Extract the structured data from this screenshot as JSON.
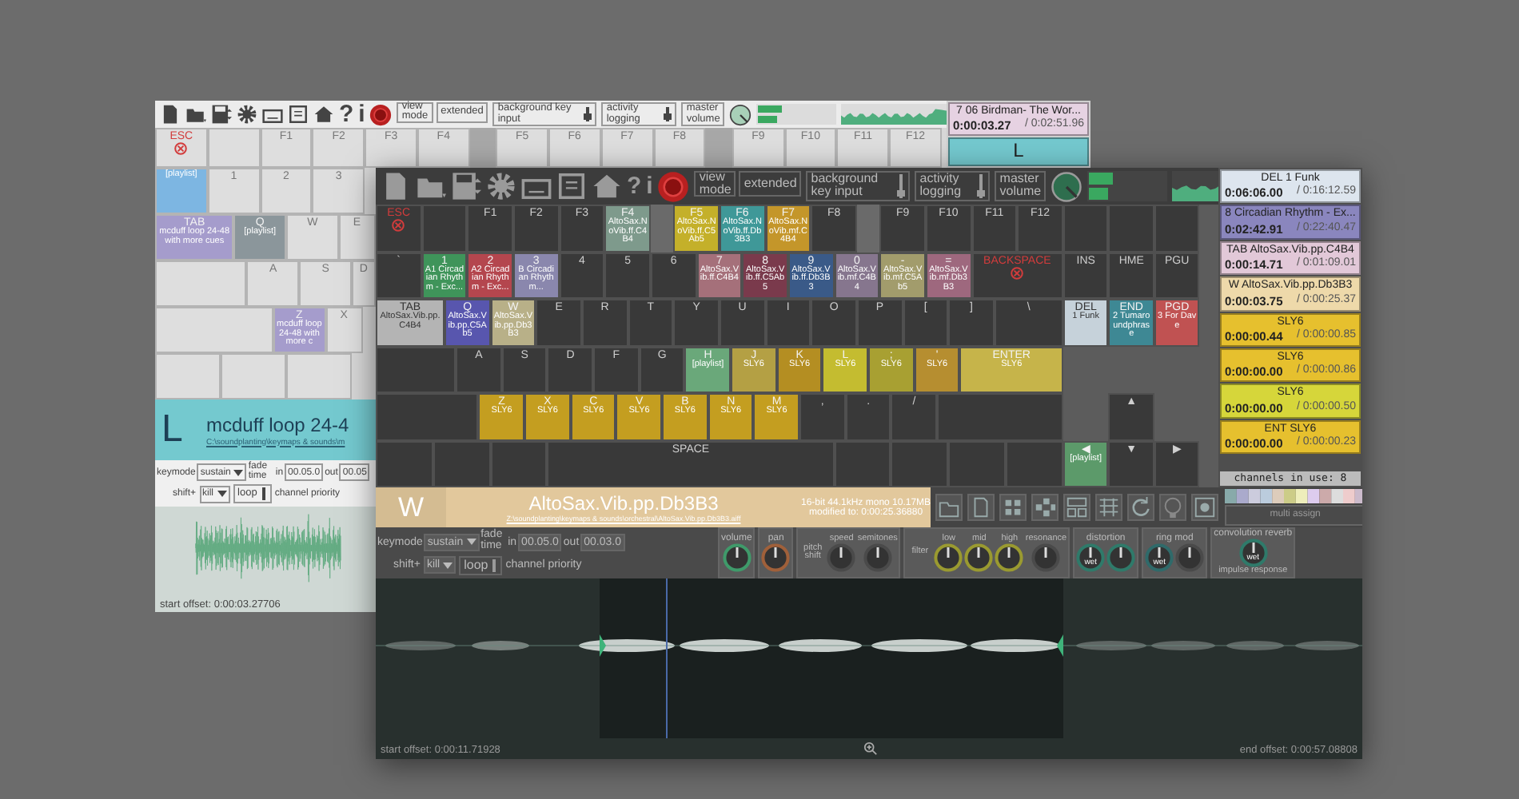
{
  "back_window": {
    "toolbar": {
      "help": "?",
      "info": "i",
      "view_mode": "view mode",
      "view_option": "extended",
      "background": "background key input",
      "logging": "activity logging",
      "master": "master volume"
    },
    "keyboard": {
      "rows": [
        {
          "keys": [
            {
              "kind": "key",
              "label": "ESC",
              "alert": true
            },
            {
              "kind": "key"
            },
            {
              "kind": "key",
              "label": "F1"
            },
            {
              "kind": "key",
              "label": "F2"
            },
            {
              "kind": "key",
              "label": "F3"
            },
            {
              "kind": "key",
              "label": "F4"
            },
            {
              "kind": "gap"
            },
            {
              "kind": "key",
              "label": "F5"
            },
            {
              "kind": "key",
              "label": "F6"
            },
            {
              "kind": "key",
              "label": "F7"
            },
            {
              "kind": "key",
              "label": "F8"
            },
            {
              "kind": "gap"
            },
            {
              "kind": "key",
              "label": "F9"
            },
            {
              "kind": "key",
              "label": "F10"
            },
            {
              "kind": "key",
              "label": "F11"
            },
            {
              "kind": "key",
              "label": "F12"
            }
          ]
        },
        {
          "keys": [
            {
              "kind": "key",
              "sound": "[playlist]",
              "color": "#7db6e2"
            },
            {
              "kind": "key",
              "label": "1"
            },
            {
              "kind": "key",
              "label": "2"
            },
            {
              "kind": "key",
              "label": "3"
            }
          ]
        },
        {
          "keys": [
            {
              "kind": "tab",
              "label": "TAB",
              "sound": "mcduff loop 24-48 with more cues",
              "color": "#a59ccc"
            },
            {
              "kind": "key",
              "label": "Q",
              "sound": "[playlist]",
              "color": "#8b969b"
            },
            {
              "kind": "key",
              "label": "W"
            },
            {
              "kind": "edge",
              "label": "E"
            }
          ]
        },
        {
          "keys": [
            {
              "kind": "caps"
            },
            {
              "kind": "key",
              "label": "A"
            },
            {
              "kind": "key",
              "label": "S"
            },
            {
              "kind": "sliver",
              "label": "D"
            }
          ]
        },
        {
          "keys": [
            {
              "kind": "lshift"
            },
            {
              "kind": "key",
              "label": "Z",
              "sound": "mcduff loop 24-48 with more c",
              "color": "#a59ccc"
            },
            {
              "kind": "edge",
              "label": "X"
            }
          ]
        },
        {
          "keys": [
            {
              "kind": "mod"
            },
            {
              "kind": "mod"
            },
            {
              "kind": "mod"
            }
          ]
        }
      ]
    },
    "playlist": [
      {
        "key": "7",
        "title": "06 Birdman- The Wor...",
        "elapsed": "0:00:03.27",
        "total": "/ 0:02:51.96",
        "color": "#e6d2e2"
      },
      {
        "key": "L",
        "color": "#74c9cf"
      }
    ],
    "sound": {
      "key": "L",
      "name": "mcduff loop 24-4",
      "path": "C:\\soundplanting\\keymaps & sounds\\m",
      "color": "#74c9cf"
    },
    "controls": {
      "keymode": "keymode",
      "keymode_value": "sustain",
      "fade": "fade time",
      "in": "in",
      "fade_in": "00.05.0",
      "out": "out",
      "fade_out": "00.05",
      "shift": "shift+",
      "shift_value": "kill",
      "loop": "loop",
      "priority": "channel priority"
    },
    "start_offset": "start offset: 0:00:03.27706"
  },
  "front_window": {
    "toolbar": {
      "help": "?",
      "info": "i",
      "view_mode": "view mode",
      "view_option": "extended",
      "background": "background key input",
      "logging": "activity logging",
      "master": "master volume"
    },
    "keyboard": {
      "rows": [
        {
          "keys": [
            {
              "kind": "key",
              "label": "ESC",
              "alert": true
            },
            {
              "kind": "key"
            },
            {
              "kind": "key",
              "label": "F1"
            },
            {
              "kind": "key",
              "label": "F2"
            },
            {
              "kind": "key",
              "label": "F3"
            },
            {
              "kind": "key",
              "label": "F4",
              "sound": "AltoSax.NoVib.ff.C4B4",
              "color": "#7e9a8c"
            },
            {
              "kind": "gap"
            },
            {
              "kind": "key",
              "label": "F5",
              "sound": "AltoSax.NoVib.ff.C5Ab5",
              "color": "#c4b02a"
            },
            {
              "kind": "key",
              "label": "F6",
              "sound": "AltoSax.NoVib.ff.Db3B3",
              "color": "#3f9898"
            },
            {
              "kind": "key",
              "label": "F7",
              "sound": "AltoSax.NoVib.mf.C4B4",
              "color": "#c4962a"
            },
            {
              "kind": "key",
              "label": "F8"
            },
            {
              "kind": "gap"
            },
            {
              "kind": "key",
              "label": "F9"
            },
            {
              "kind": "key",
              "label": "F10"
            },
            {
              "kind": "key",
              "label": "F11"
            },
            {
              "kind": "key",
              "label": "F12"
            }
          ],
          "nav": [
            {
              "kind": "key"
            },
            {
              "kind": "key"
            },
            {
              "kind": "key"
            }
          ]
        },
        {
          "keys": [
            {
              "kind": "key",
              "label": "`"
            },
            {
              "kind": "key",
              "label": "1",
              "sound": "A1 Circadian Rhythm - Exc...",
              "color": "#3f945a"
            },
            {
              "kind": "key",
              "label": "2",
              "sound": "A2 Circadian Rhythm - Exc...",
              "color": "#b4464e"
            },
            {
              "kind": "key",
              "label": "3",
              "sound": "B Circadian Rhythm...",
              "color": "#8a87ad"
            },
            {
              "kind": "key",
              "label": "4"
            },
            {
              "kind": "key",
              "label": "5"
            },
            {
              "kind": "key",
              "label": "6"
            },
            {
              "kind": "key",
              "label": "7",
              "sound": "AltoSax.Vib.ff.C4B4",
              "color": "#a5707a"
            },
            {
              "kind": "key",
              "label": "8",
              "sound": "AltoSax.Vib.ff.C5Ab5",
              "color": "#7a3a4c"
            },
            {
              "kind": "key",
              "label": "9",
              "sound": "AltoSax.Vib.ff.Db3B3",
              "color": "#3a5a88"
            },
            {
              "kind": "key",
              "label": "0",
              "sound": "AltoSax.Vib.mf.C4B4",
              "color": "#86768e"
            },
            {
              "kind": "key",
              "label": "-",
              "sound": "AltoSax.Vib.mf.C5Ab5",
              "color": "#a29c6c"
            },
            {
              "kind": "key",
              "label": "=",
              "sound": "AltoSax.Vib.mf.Db3B3",
              "color": "#9e687e"
            },
            {
              "kind": "backspace",
              "label": "BACKSPACE",
              "alert": true
            }
          ],
          "nav": [
            {
              "kind": "key",
              "label": "INS"
            },
            {
              "kind": "key",
              "label": "HME"
            },
            {
              "kind": "key",
              "label": "PGU"
            }
          ]
        },
        {
          "keys": [
            {
              "kind": "tab",
              "label": "TAB",
              "sound": "AltoSax.Vib.pp.C4B4",
              "color": "#b4b4b4"
            },
            {
              "kind": "key",
              "label": "Q",
              "sound": "AltoSax.Vib.pp.C5Ab5",
              "color": "#5856ae"
            },
            {
              "kind": "key",
              "label": "W",
              "sound": "AltoSax.Vib.pp.Db3B3",
              "color": "#b8b088"
            },
            {
              "kind": "key",
              "label": "E"
            },
            {
              "kind": "key",
              "label": "R"
            },
            {
              "kind": "key",
              "label": "T"
            },
            {
              "kind": "key",
              "label": "Y"
            },
            {
              "kind": "key",
              "label": "U"
            },
            {
              "kind": "key",
              "label": "I"
            },
            {
              "kind": "key",
              "label": "O"
            },
            {
              "kind": "key",
              "label": "P"
            },
            {
              "kind": "key",
              "label": "["
            },
            {
              "kind": "key",
              "label": "]"
            },
            {
              "kind": "tab",
              "label": "\\"
            }
          ],
          "nav": [
            {
              "kind": "key",
              "label": "DEL",
              "sound": "1 Funk",
              "color": "#c6d2da"
            },
            {
              "kind": "key",
              "label": "END",
              "sound": "2 Tumaroundphrase",
              "color": "#3e8894"
            },
            {
              "kind": "key",
              "label": "PGD",
              "sound": "3 For Dave",
              "color": "#c05252"
            }
          ]
        },
        {
          "keys": [
            {
              "kind": "caps"
            },
            {
              "kind": "key",
              "label": "A"
            },
            {
              "kind": "key",
              "label": "S"
            },
            {
              "kind": "key",
              "label": "D"
            },
            {
              "kind": "key",
              "label": "F"
            },
            {
              "kind": "key",
              "label": "G"
            },
            {
              "kind": "key",
              "label": "H",
              "sound": "[playlist]",
              "color": "#6aa87a"
            },
            {
              "kind": "key",
              "label": "J",
              "sound": "SLY6",
              "color": "#b4a044"
            },
            {
              "kind": "key",
              "label": "K",
              "sound": "SLY6",
              "color": "#b48e22"
            },
            {
              "kind": "key",
              "label": "L",
              "sound": "SLY6",
              "color": "#c4bc30"
            },
            {
              "kind": "key",
              "label": ";",
              "sound": "SLY6",
              "color": "#a8a032"
            },
            {
              "kind": "key",
              "label": "'",
              "sound": "SLY6",
              "color": "#b68e30"
            },
            {
              "kind": "enter",
              "label": "ENTER",
              "sound": "SLY6",
              "color": "#c6b44a"
            }
          ],
          "nav": [
            {
              "kind": "none"
            },
            {
              "kind": "none"
            },
            {
              "kind": "none"
            }
          ]
        },
        {
          "keys": [
            {
              "kind": "lshift"
            },
            {
              "kind": "key",
              "label": "Z",
              "sound": "SLY6",
              "color": "#c49e20"
            },
            {
              "kind": "key",
              "label": "X",
              "sound": "SLY6",
              "color": "#c49e20"
            },
            {
              "kind": "key",
              "label": "C",
              "sound": "SLY6",
              "color": "#c49e20"
            },
            {
              "kind": "key",
              "label": "V",
              "sound": "SLY6",
              "color": "#c49e20"
            },
            {
              "kind": "key",
              "label": "B",
              "sound": "SLY6",
              "color": "#c49e20"
            },
            {
              "kind": "key",
              "label": "N",
              "sound": "SLY6",
              "color": "#c49e20"
            },
            {
              "kind": "key",
              "label": "M",
              "sound": "SLY6",
              "color": "#c49e20"
            },
            {
              "kind": "key",
              "label": ","
            },
            {
              "kind": "key",
              "label": "."
            },
            {
              "kind": "key",
              "label": "/"
            },
            {
              "kind": "rshift"
            }
          ],
          "nav": [
            {
              "kind": "none"
            },
            {
              "kind": "key",
              "label": "▲"
            },
            {
              "kind": "none"
            }
          ]
        },
        {
          "keys": [
            {
              "kind": "mod"
            },
            {
              "kind": "mod"
            },
            {
              "kind": "mod"
            },
            {
              "kind": "space",
              "label": "SPACE"
            },
            {
              "kind": "mod"
            },
            {
              "kind": "mod"
            },
            {
              "kind": "mod"
            },
            {
              "kind": "mod"
            }
          ],
          "nav": [
            {
              "kind": "key",
              "label": "◀",
              "sound": "[playlist]",
              "color": "#5c9a6a"
            },
            {
              "kind": "key",
              "label": "▼"
            },
            {
              "kind": "key",
              "label": "▶"
            }
          ]
        }
      ]
    },
    "playlist": [
      {
        "key": "DEL",
        "title": "1 Funk",
        "elapsed": "0:06:06.00",
        "total": "/ 0:16:12.59",
        "color": "#dde5ee"
      },
      {
        "key": "8",
        "title": "Circadian Rhythm - Ex...",
        "elapsed": "0:02:42.91",
        "total": "/ 0:22:40.47",
        "color": "#8a86be"
      },
      {
        "key": "TAB",
        "title": "AltoSax.Vib.pp.C4B4",
        "elapsed": "0:00:14.71",
        "total": "/ 0:01:09.01",
        "color": "#e2c8d8"
      },
      {
        "key": "W",
        "title": "AltoSax.Vib.pp.Db3B3",
        "elapsed": "0:00:03.75",
        "total": "/ 0:00:25.37",
        "color": "#eed9aa"
      },
      {
        "title": "SLY6",
        "elapsed": "0:00:00.44",
        "total": "/ 0:00:00.85",
        "color": "#e6c02e"
      },
      {
        "title": "SLY6",
        "elapsed": "0:00:00.00",
        "total": "/ 0:00:00.86",
        "color": "#e6c02e"
      },
      {
        "title": "SLY6",
        "elapsed": "0:00:00.00",
        "total": "/ 0:00:00.50",
        "color": "#d6d63a"
      },
      {
        "key": "ENT",
        "title": "SLY6",
        "elapsed": "0:00:00.00",
        "total": "/ 0:00:00.23",
        "color": "#e6c02e"
      }
    ],
    "channels": "channels in use: 8",
    "multi_assign": "multi assign",
    "sound": {
      "key": "W",
      "name": "AltoSax.Vib.pp.Db3B3",
      "path": "Z:\\soundplanting\\keymaps & sounds\\orchestral\\AltoSax.Vib.pp.Db3B3.aiff",
      "format": "16-bit 44.1kHz mono 10.17MB",
      "modified": "modified to: 0:00:25.36880",
      "color": "#e2c89c"
    },
    "controls": {
      "keymode": "keymode",
      "keymode_value": "sustain",
      "fade": "fade time",
      "in": "in",
      "fade_in": "00.05.0",
      "out": "out",
      "fade_out": "00.03.0",
      "shift": "shift+",
      "shift_value": "kill",
      "loop": "loop",
      "priority": "channel priority"
    },
    "effects": [
      {
        "title": "volume",
        "knobs": [
          {
            "color": "#3f9a6a"
          }
        ]
      },
      {
        "title": "pan",
        "knobs": [
          {
            "color": "#a0603a"
          }
        ]
      },
      {
        "side": "pitch shift",
        "knobs": [
          {
            "label": "speed",
            "color": "#4a4a4a"
          },
          {
            "label": "semitones",
            "color": "#4a4a4a"
          }
        ]
      },
      {
        "side": "filter",
        "knobs": [
          {
            "label": "low",
            "color": "#9a9a30"
          },
          {
            "label": "mid",
            "color": "#9a9a30"
          },
          {
            "label": "high",
            "color": "#9a9a30"
          },
          {
            "label": "resonance",
            "color": "#4a4a4a"
          }
        ]
      },
      {
        "title": "distortion",
        "knobs": [
          {
            "inner": "wet",
            "color": "#2f7a6a"
          },
          {
            "color": "#2f7a6a"
          }
        ]
      },
      {
        "title": "ring mod",
        "knobs": [
          {
            "inner": "wet",
            "color": "#2f6a6a"
          },
          {
            "color": "#4a4a4a"
          }
        ]
      },
      {
        "title": "convolution reverb",
        "extra": "impulse response",
        "knobs": [
          {
            "inner": "wet",
            "color": "#2f7a6a"
          }
        ]
      }
    ],
    "start_offset": "start offset: 0:00:11.71928",
    "end_offset": "end offset: 0:00:57.08808"
  }
}
